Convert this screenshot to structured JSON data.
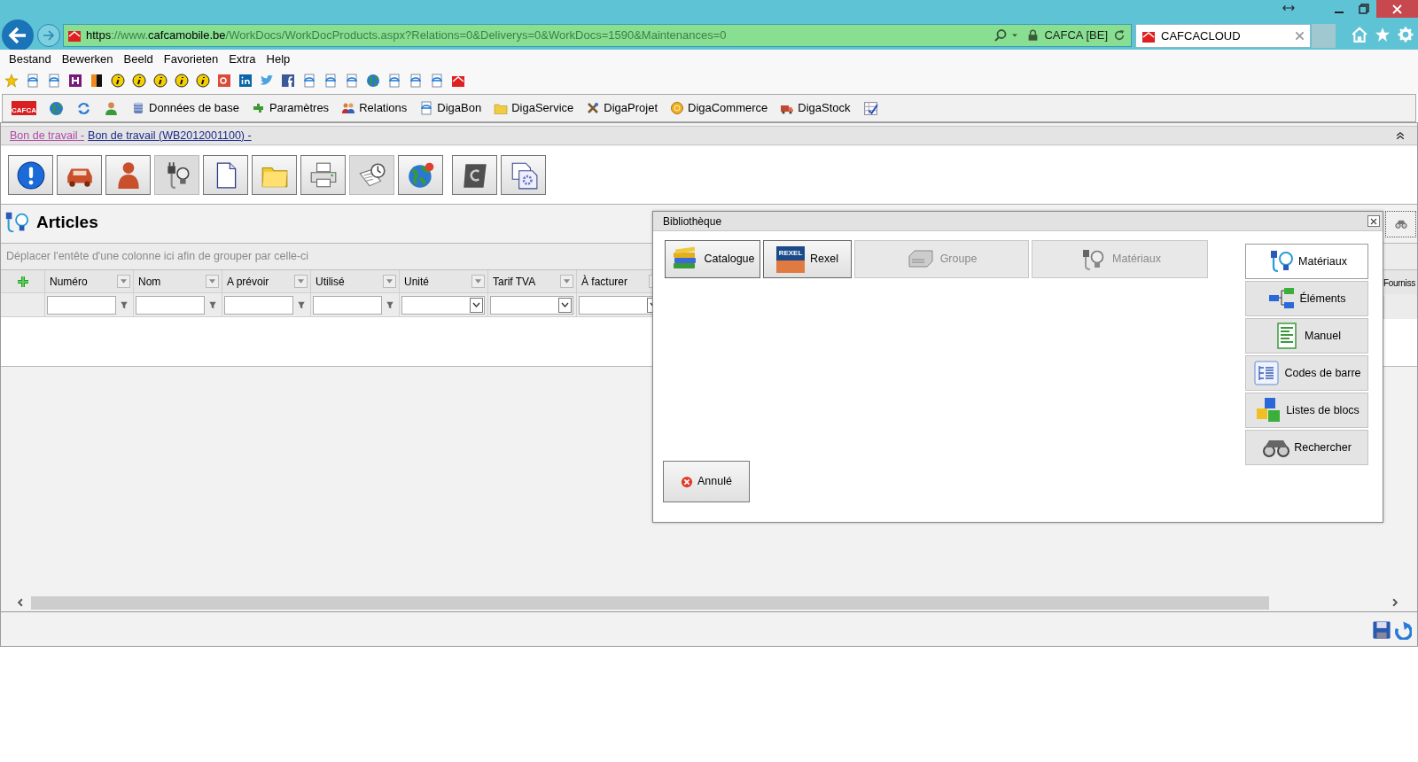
{
  "browser": {
    "address": {
      "scheme": "https",
      "rest_prefix": "://www.",
      "domain": "cafcamobile.be",
      "path": "/WorkDocs/WorkDocProducts.aspx?Relations=0&Deliverys=0&WorkDocs=1590&Maintenances=0"
    },
    "site_identity": "CAFCA [BE]",
    "tab": {
      "title": "CAFCACLOUD"
    }
  },
  "menu": [
    "Bestand",
    "Bewerken",
    "Beeld",
    "Favorieten",
    "Extra",
    "Help"
  ],
  "favorites": [
    {
      "kind": "star"
    },
    {
      "kind": "page"
    },
    {
      "kind": "page"
    },
    {
      "kind": "magenta"
    },
    {
      "kind": "flag"
    },
    {
      "kind": "info"
    },
    {
      "kind": "info"
    },
    {
      "kind": "info"
    },
    {
      "kind": "info"
    },
    {
      "kind": "info"
    },
    {
      "kind": "red"
    },
    {
      "kind": "linkedin"
    },
    {
      "kind": "bird"
    },
    {
      "kind": "facebook"
    },
    {
      "kind": "page"
    },
    {
      "kind": "page"
    },
    {
      "kind": "page"
    },
    {
      "kind": "globe"
    },
    {
      "kind": "page"
    },
    {
      "kind": "page"
    },
    {
      "kind": "page"
    },
    {
      "kind": "house"
    }
  ],
  "app_toolbar": [
    {
      "kind": "logo",
      "label": "CAFCA"
    },
    {
      "kind": "globe"
    },
    {
      "kind": "refresh"
    },
    {
      "kind": "person"
    },
    {
      "kind": "database",
      "label": "Données de base"
    },
    {
      "kind": "puzzle",
      "label": "Paramètres"
    },
    {
      "kind": "people",
      "label": "Relations"
    },
    {
      "kind": "page",
      "label": "DigaBon"
    },
    {
      "kind": "folder",
      "label": "DigaService"
    },
    {
      "kind": "tools",
      "label": "DigaProjet"
    },
    {
      "kind": "coin",
      "label": "DigaCommerce"
    },
    {
      "kind": "truck",
      "label": "DigaStock"
    },
    {
      "kind": "checklist"
    }
  ],
  "breadcrumb": [
    {
      "label": "Bon de travail -",
      "visited": true
    },
    {
      "label": "Bon de travail (WB2012001100) -",
      "visited": false
    }
  ],
  "icon_buttons": [
    {
      "kind": "info",
      "selected": false
    },
    {
      "kind": "car",
      "selected": false
    },
    {
      "kind": "person",
      "selected": false
    },
    {
      "kind": "plug",
      "selected": true
    },
    {
      "kind": "document",
      "selected": false
    },
    {
      "kind": "folder",
      "selected": false
    },
    {
      "kind": "printer",
      "selected": false
    },
    {
      "kind": "clock",
      "selected": true
    },
    {
      "kind": "globe",
      "selected": false
    },
    {
      "kind": "c-tile",
      "selected": false
    },
    {
      "kind": "gears",
      "selected": false
    }
  ],
  "section": {
    "title": "Articles"
  },
  "grid": {
    "group_hint": "Déplacer l'entête d'une colonne ici afin de grouper par celle-ci",
    "columns": [
      {
        "label": "Numéro",
        "kind": "text"
      },
      {
        "label": "Nom",
        "kind": "text"
      },
      {
        "label": "A prévoir",
        "kind": "text"
      },
      {
        "label": "Utilisé",
        "kind": "text"
      },
      {
        "label": "Unité",
        "kind": "select"
      },
      {
        "label": "Tarif TVA",
        "kind": "select"
      },
      {
        "label": "À facturer",
        "kind": "select"
      }
    ],
    "last_column": "Fourniss"
  },
  "dialog": {
    "title": "Bibliothèque",
    "sources": [
      {
        "kind": "books",
        "label": "Catalogue",
        "disabled": false
      },
      {
        "kind": "rexel",
        "logo": "REXEL",
        "label": "Rexel",
        "disabled": false
      },
      {
        "kind": "server",
        "label": "Groupe",
        "disabled": true
      },
      {
        "kind": "plug",
        "label": "Matériaux",
        "disabled": true
      }
    ],
    "side_tabs": [
      {
        "kind": "plug",
        "label": "Matériaux",
        "selected": true
      },
      {
        "kind": "tree",
        "label": "Éléments",
        "selected": false
      },
      {
        "kind": "sheet",
        "label": "Manuel",
        "selected": false
      },
      {
        "kind": "list",
        "label": "Codes de barre",
        "selected": false
      },
      {
        "kind": "cubes",
        "label": "Listes de blocs",
        "selected": false
      },
      {
        "kind": "binoculars",
        "label": "Rechercher",
        "selected": false
      }
    ],
    "cancel": "Annulé"
  }
}
